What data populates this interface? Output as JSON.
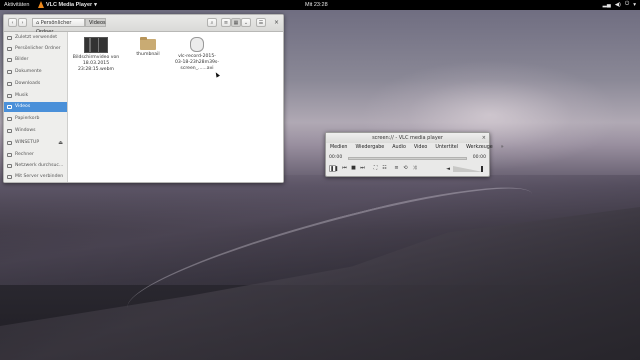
{
  "topbar": {
    "activities": "Aktivitäten",
    "app_name": "VLC Media Player",
    "app_menu_arrow": "▾",
    "clock": "Mit 23:28",
    "system_arrow": "▾"
  },
  "file_manager": {
    "nav_back": "‹",
    "nav_forward": "›",
    "breadcrumb_home": "Persönlicher Ordner",
    "breadcrumb_current": "Videos",
    "search_icon": "⌕",
    "view_icon": "≡",
    "menu_icon": "☰",
    "close_icon": "×",
    "sidebar": [
      {
        "label": "Zuletzt verwendet",
        "icon": "clock-icon"
      },
      {
        "label": "Persönlicher Ordner",
        "icon": "home-icon"
      },
      {
        "label": "Bilder",
        "icon": "pictures-icon"
      },
      {
        "label": "Dokumente",
        "icon": "documents-icon"
      },
      {
        "label": "Downloads",
        "icon": "downloads-icon"
      },
      {
        "label": "Musik",
        "icon": "music-icon"
      },
      {
        "label": "Videos",
        "icon": "videos-icon",
        "selected": true
      },
      {
        "label": "Papierkorb",
        "icon": "trash-icon"
      },
      {
        "label": "Windows",
        "icon": "drive-icon"
      },
      {
        "label": "WINSETUP",
        "icon": "drive-icon",
        "eject": "⏏"
      },
      {
        "label": "Rechner",
        "icon": "computer-icon"
      },
      {
        "label": "Netzwerk durchsuc...",
        "icon": "network-icon"
      },
      {
        "label": "Mit Server verbinden",
        "icon": "server-icon"
      }
    ],
    "files": [
      {
        "name_line1": "Bildschirmvideo von",
        "name_line2": "18.03.2015",
        "name_line3": "23:28:15.webm",
        "kind": "video-thumbnail"
      },
      {
        "name_line1": "thumbnail",
        "name_line2": "",
        "name_line3": "",
        "kind": "folder"
      },
      {
        "name_line1": "vlc-record-2015-",
        "name_line2": "03-18-23h28m39s-",
        "name_line3": "screen_......avi",
        "kind": "generic-file"
      }
    ]
  },
  "vlc": {
    "title": "screen:// - VLC media player",
    "close": "×",
    "menu": [
      "Medien",
      "Wiedergabe",
      "Audio",
      "Video",
      "Untertitel",
      "Werkzeuge"
    ],
    "menu_more": "»",
    "time_elapsed": "00:00",
    "time_total": "00:00",
    "controls": {
      "pause": "❚❚",
      "prev": "⏮",
      "stop": "■",
      "next": "⏭",
      "fullscreen": "⛶",
      "extended": "☷",
      "playlist": "≡",
      "loop": "⟲",
      "shuffle": "⤨"
    },
    "volume_icon": "◄",
    "volume_level": 1.0
  }
}
